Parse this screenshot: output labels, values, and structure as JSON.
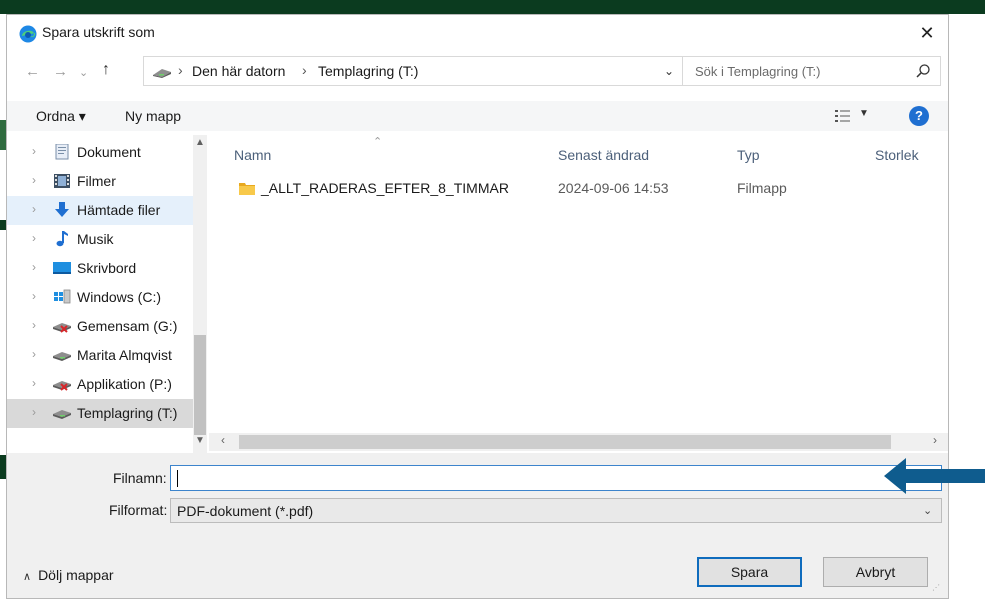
{
  "dialog": {
    "title": "Spara utskrift som",
    "close_glyph": "✕"
  },
  "address_bar": {
    "crumbs": [
      "Den här datorn",
      "Templagring (T:)"
    ],
    "separator": "›"
  },
  "search": {
    "placeholder": "Sök i Templagring (T:)"
  },
  "toolbar": {
    "organize_label": "Ordna ▾",
    "new_folder_label": "Ny mapp",
    "help_glyph": "?"
  },
  "nav_pane": {
    "items": [
      {
        "label": "Dokument",
        "icon": "documents-icon"
      },
      {
        "label": "Filmer",
        "icon": "videos-icon"
      },
      {
        "label": "Hämtade filer",
        "icon": "downloads-icon"
      },
      {
        "label": "Musik",
        "icon": "music-icon"
      },
      {
        "label": "Skrivbord",
        "icon": "desktop-icon"
      },
      {
        "label": "Windows (C:)",
        "icon": "windows-drive-icon"
      },
      {
        "label": "Gemensam (G:)",
        "icon": "disconnected-drive-icon"
      },
      {
        "label": "Marita Almqvist",
        "icon": "network-drive-icon"
      },
      {
        "label": "Applikation (P:)",
        "icon": "disconnected-drive-icon"
      },
      {
        "label": "Templagring (T:)",
        "icon": "network-drive-icon"
      }
    ]
  },
  "file_list": {
    "columns": [
      "Namn",
      "Senast ändrad",
      "Typ",
      "Storlek"
    ],
    "rows": [
      {
        "name": "_ALLT_RADERAS_EFTER_8_TIMMAR",
        "modified": "2024-09-06 14:53",
        "type": "Filmapp",
        "size": ""
      }
    ]
  },
  "form": {
    "filename_label": "Filnamn:",
    "filename_value": "",
    "format_label": "Filformat:",
    "format_value": "PDF-dokument (*.pdf)"
  },
  "footer": {
    "hide_folders_label": "Dölj mappar",
    "save_label": "Spara",
    "cancel_label": "Avbryt"
  },
  "colors": {
    "accent": "#1f6fd1",
    "annotation_arrow": "#0f5c8e",
    "selected_item": "#d9d9d9",
    "hover_item": "#e5f0fb"
  }
}
